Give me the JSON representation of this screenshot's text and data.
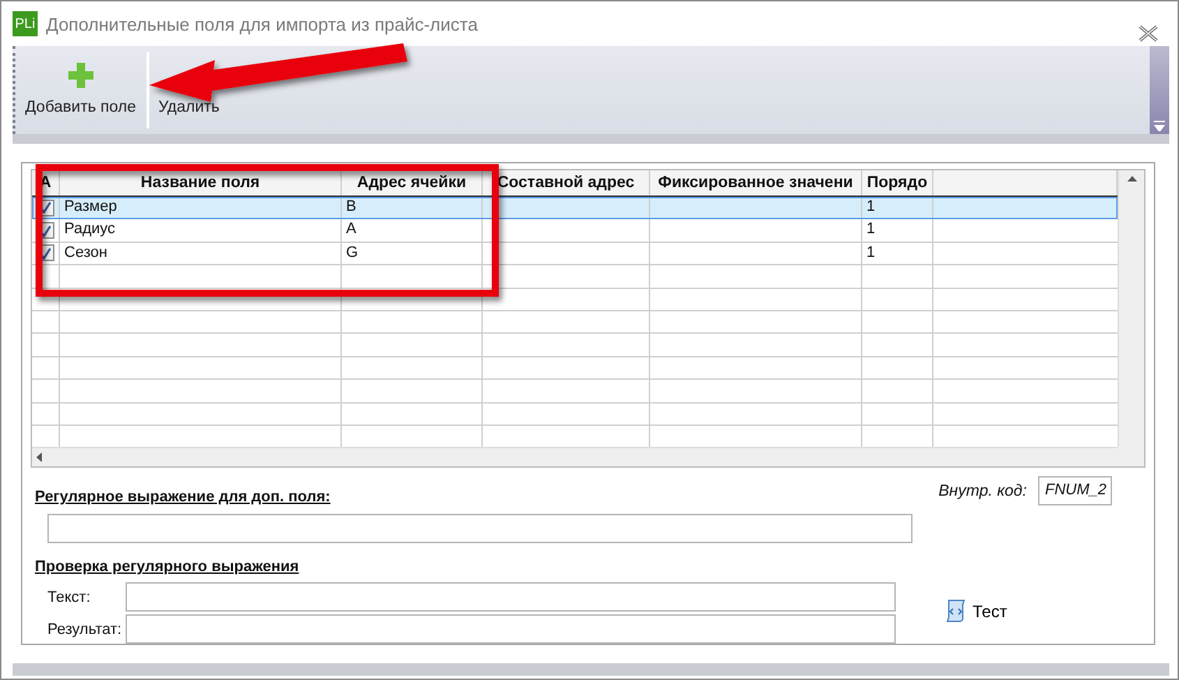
{
  "window": {
    "logo": "PLi",
    "title": "Дополнительные поля для импорта из прайс-листа"
  },
  "toolbar": [
    {
      "kind": "add",
      "label": "Добавить поле"
    },
    {
      "kind": "plain",
      "label": "Удалить"
    }
  ],
  "grid": {
    "columns": [
      "A",
      "Название поля",
      "Адрес ячейки",
      "Составной адрес",
      "Фиксированное значени",
      "Порядо"
    ],
    "rows": [
      {
        "checked": true,
        "selected": true,
        "name": "Размер",
        "address": "B",
        "order": "1"
      },
      {
        "checked": true,
        "selected": false,
        "name": "Радиус",
        "address": "A",
        "order": "1"
      },
      {
        "checked": true,
        "selected": false,
        "name": "Сезон",
        "address": "G",
        "order": "1"
      }
    ]
  },
  "code": {
    "label": "Внутр. код:",
    "value": "FNUM_2"
  },
  "regex": {
    "label": "Регулярное выражение для доп. поля:"
  },
  "check": {
    "title": "Проверка регулярного выражения",
    "fields": [
      {
        "label": "Текст:"
      },
      {
        "label": "Результат:"
      }
    ],
    "button": "Тест"
  }
}
